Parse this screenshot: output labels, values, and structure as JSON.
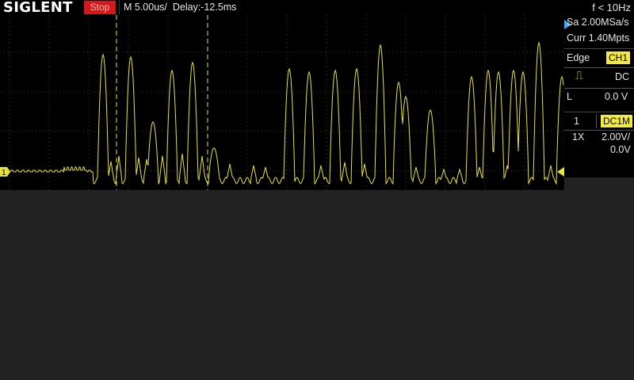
{
  "header": {
    "logo": "SIGLENT",
    "run_state": "Stop",
    "timebase": "M 5.00us/",
    "delay": "Delay:-12.5ms",
    "trigger_freq": "f < 10Hz"
  },
  "acquisition": {
    "sample_rate": "Sa 2.00MSa/s",
    "memory": "Curr 1.40Mpts"
  },
  "trigger": {
    "type": "Edge",
    "source": "CH1",
    "coupling": "DC",
    "mode": "L",
    "level": "0.0 V"
  },
  "channel": {
    "number": "1",
    "coupling": "DC1M",
    "probe": "1X",
    "scale": "2.00V/",
    "offset": "0.0V"
  },
  "markers": {
    "channel_marker": "1"
  },
  "colors": {
    "trace": "#e8e33a",
    "accent_blue": "#3fa6ff",
    "stop_red": "#d21a1a",
    "badge_yellow": "#f2ea3c"
  }
}
